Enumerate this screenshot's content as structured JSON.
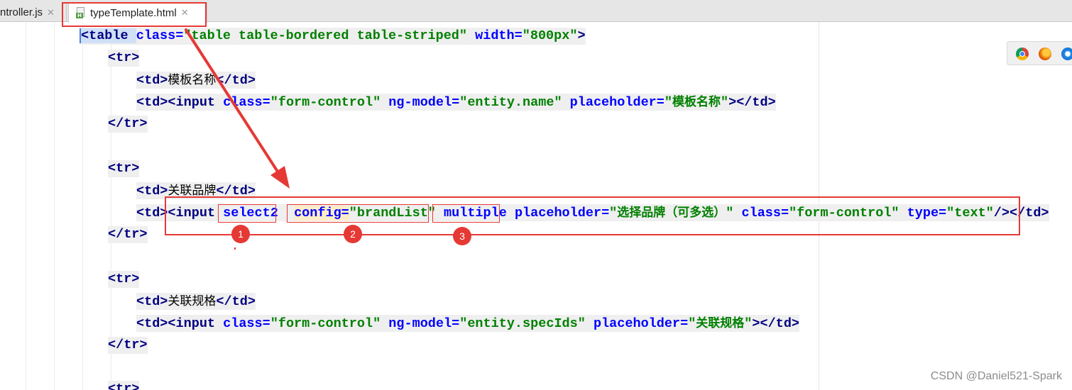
{
  "tabs": [
    {
      "label": "ntroller.js",
      "active": false
    },
    {
      "label": "typeTemplate.html",
      "active": true
    }
  ],
  "close_glyph": "✕",
  "file_badge": "H",
  "code": {
    "l1": {
      "open": "<table ",
      "a1": "class=",
      "v1": "\"table table-bordered table-striped\"",
      "a2": " width=",
      "v2": "\"800px\"",
      "close": ">"
    },
    "l2": "<tr>",
    "l3": {
      "open": "<td>",
      "text": "模板名称",
      "close": "</td>"
    },
    "l4": {
      "open": "<td><input ",
      "a1": "class=",
      "v1": "\"form-control\"",
      "a2": " ng-model=",
      "v2": "\"entity.name\"",
      "a3": " placeholder=",
      "v3_open": "\"",
      "v3_text": "模板名称",
      "v3_close": "\"",
      "close": "></td>"
    },
    "l5": "</tr>",
    "l6": "<tr>",
    "l7": {
      "open": "<td>",
      "text": "关联品牌",
      "close": "</td>"
    },
    "l8": {
      "open": "<td><input ",
      "a1": "select2",
      "a2": "config=",
      "v2": "\"brandList\"",
      "a3": "multiple",
      "a4": " placeholder=",
      "v4_open": "\"",
      "v4_text": "选择品牌（可多选）",
      "v4_close": "\"",
      "a5": " class=",
      "v5": "\"form-control\"",
      "a6": " type=",
      "v6": "\"text\"",
      "close1": "/>",
      "close2": "</td>"
    },
    "l9": "</tr>",
    "l10": "<tr>",
    "l11": {
      "open": "<td>",
      "text": "关联规格",
      "close": "</td>"
    },
    "l12": {
      "open": "<td><input ",
      "a1": "class=",
      "v1": "\"form-control\"",
      "a2": " ng-model=",
      "v2": "\"entity.specIds\"",
      "a3": " placeholder=",
      "v3_open": "\"",
      "v3_text": "关联规格",
      "v3_close": "\"",
      "close": "></td>"
    },
    "l13": "</tr>",
    "l14": "<tr>"
  },
  "annotations": [
    "1",
    "2",
    "3"
  ],
  "annotation_color": "#e53935",
  "browser_icons": [
    "chrome-icon",
    "firefox-icon",
    "safari-icon"
  ],
  "watermark": "CSDN @Daniel521-Spark"
}
